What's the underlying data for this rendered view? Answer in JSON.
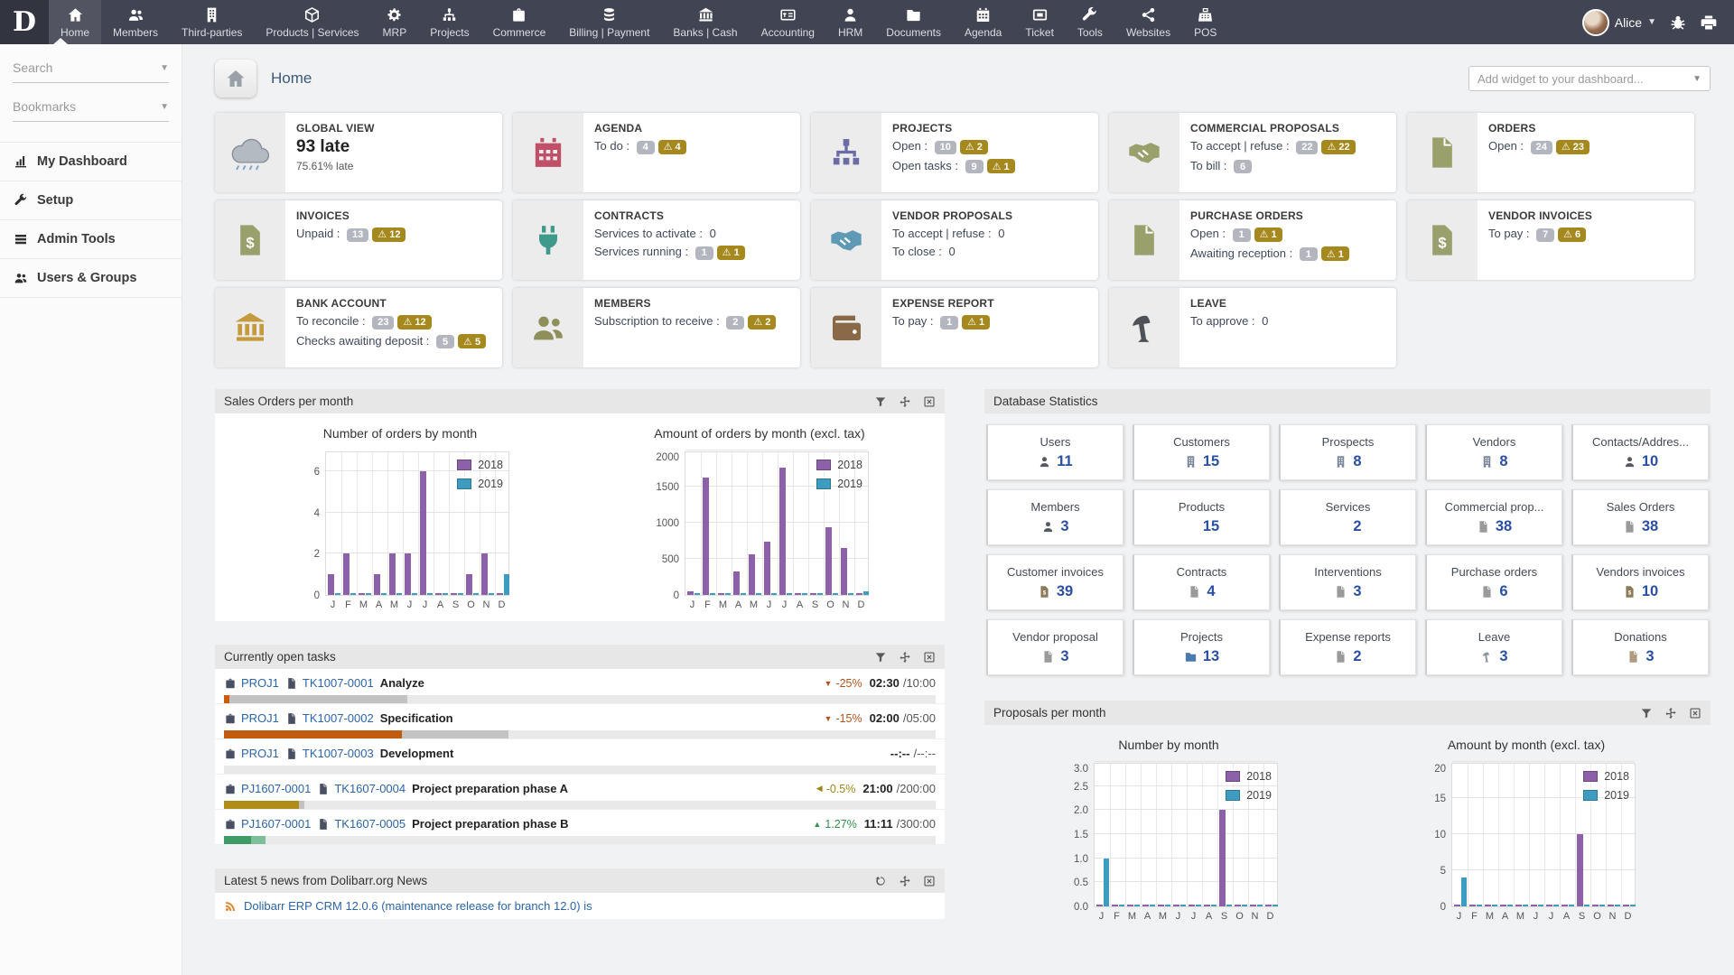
{
  "navbar": {
    "logo_text": "D",
    "items": [
      {
        "label": "Home",
        "icon": "home",
        "active": true
      },
      {
        "label": "Members",
        "icon": "users",
        "active": false
      },
      {
        "label": "Third-parties",
        "icon": "building",
        "active": false
      },
      {
        "label": "Products | Services",
        "icon": "box",
        "active": false
      },
      {
        "label": "MRP",
        "icon": "mrp",
        "active": false
      },
      {
        "label": "Projects",
        "icon": "sitemap",
        "active": false
      },
      {
        "label": "Commerce",
        "icon": "briefcase",
        "active": false
      },
      {
        "label": "Billing | Payment",
        "icon": "coins",
        "active": false
      },
      {
        "label": "Banks | Cash",
        "icon": "bank",
        "active": false
      },
      {
        "label": "Accounting",
        "icon": "calculator",
        "active": false
      },
      {
        "label": "HRM",
        "icon": "person",
        "active": false
      },
      {
        "label": "Documents",
        "icon": "folder",
        "active": false
      },
      {
        "label": "Agenda",
        "icon": "calendar",
        "active": false
      },
      {
        "label": "Ticket",
        "icon": "ticket",
        "active": false
      },
      {
        "label": "Tools",
        "icon": "wrench",
        "active": false
      },
      {
        "label": "Websites",
        "icon": "share",
        "active": false
      },
      {
        "label": "POS",
        "icon": "pos",
        "active": false
      }
    ],
    "user_name": "Alice"
  },
  "sidebar": {
    "search_placeholder": "Search",
    "bookmarks_placeholder": "Bookmarks",
    "items": [
      {
        "label": "My Dashboard",
        "icon": "chart"
      },
      {
        "label": "Setup",
        "icon": "wrench"
      },
      {
        "label": "Admin Tools",
        "icon": "list"
      },
      {
        "label": "Users & Groups",
        "icon": "users"
      }
    ]
  },
  "header": {
    "title": "Home",
    "add_widget_placeholder": "Add widget to your dashboard..."
  },
  "widgets": [
    {
      "title": "GLOBAL VIEW",
      "icon": "cloud",
      "icon_color": "#a7adb6",
      "big": "93 late",
      "sub": "75.61% late",
      "lines": []
    },
    {
      "title": "AGENDA",
      "icon": "calendar",
      "icon_color": "#bf5068",
      "lines": [
        {
          "label": "To do",
          "badge": "4",
          "warn": "4"
        }
      ]
    },
    {
      "title": "PROJECTS",
      "icon": "sitemap",
      "icon_color": "#6b6ba6",
      "lines": [
        {
          "label": "Open",
          "badge": "10",
          "warn": "2"
        },
        {
          "label": "Open tasks",
          "badge": "9",
          "warn": "1"
        }
      ]
    },
    {
      "title": "COMMERCIAL PROPOSALS",
      "icon": "handshake",
      "icon_color": "#9aa06b",
      "lines": [
        {
          "label": "To accept | refuse",
          "badge": "22",
          "warn": "22"
        },
        {
          "label": "To bill",
          "badge": "6"
        }
      ]
    },
    {
      "title": "ORDERS",
      "icon": "doc",
      "icon_color": "#9aa06b",
      "lines": [
        {
          "label": "Open",
          "badge": "24",
          "warn": "23"
        }
      ]
    },
    {
      "title": "INVOICES",
      "icon": "dollardoc",
      "icon_color": "#9aa06b",
      "lines": [
        {
          "label": "Unpaid",
          "badge": "13",
          "warn": "12"
        }
      ]
    },
    {
      "title": "CONTRACTS",
      "icon": "plug",
      "icon_color": "#3f9a8c",
      "lines": [
        {
          "label": "Services to activate",
          "plain": "0"
        },
        {
          "label": "Services running",
          "badge": "1",
          "warn": "1"
        }
      ]
    },
    {
      "title": "VENDOR PROPOSALS",
      "icon": "handshake",
      "icon_color": "#5e9ab6",
      "lines": [
        {
          "label": "To accept | refuse",
          "plain": "0"
        },
        {
          "label": "To close",
          "plain": "0"
        }
      ]
    },
    {
      "title": "PURCHASE ORDERS",
      "icon": "doc",
      "icon_color": "#9aa06b",
      "lines": [
        {
          "label": "Open",
          "badge": "1",
          "warn": "1"
        },
        {
          "label": "Awaiting reception",
          "badge": "1",
          "warn": "1"
        }
      ]
    },
    {
      "title": "VENDOR INVOICES",
      "icon": "dollardoc",
      "icon_color": "#9aa06b",
      "lines": [
        {
          "label": "To pay",
          "badge": "7",
          "warn": "6"
        }
      ]
    },
    {
      "title": "BANK ACCOUNT",
      "icon": "bank",
      "icon_color": "#c49a3c",
      "lines": [
        {
          "label": "To reconcile",
          "badge": "23",
          "warn": "12"
        },
        {
          "label": "Checks awaiting deposit",
          "badge": "5",
          "warn": "5"
        }
      ]
    },
    {
      "title": "MEMBERS",
      "icon": "users",
      "icon_color": "#8f8f5c",
      "lines": [
        {
          "label": "Subscription to receive",
          "badge": "2",
          "warn": "2"
        }
      ]
    },
    {
      "title": "EXPENSE REPORT",
      "icon": "wallet",
      "icon_color": "#8a6a46",
      "lines": [
        {
          "label": "To pay",
          "badge": "1",
          "warn": "1"
        }
      ]
    },
    {
      "title": "LEAVE",
      "icon": "palm",
      "icon_color": "#4c5258",
      "lines": [
        {
          "label": "To approve",
          "plain": "0"
        }
      ]
    }
  ],
  "panels": {
    "sales": {
      "title": "Sales Orders per month"
    },
    "tasks": {
      "title": "Currently open tasks"
    },
    "news": {
      "title": "Latest 5 news from Dolibarr.org News",
      "first_item": "Dolibarr ERP CRM 12.0.6 (maintenance release for branch 12.0) is"
    },
    "db_stats": {
      "title": "Database Statistics"
    },
    "proposals": {
      "title": "Proposals per month"
    }
  },
  "tasks": [
    {
      "project": "PROJ1",
      "ref": "TK1007-0001",
      "title": "Analyze",
      "trend": "down",
      "pct": "-25%",
      "time": "02:30",
      "total": "/10:00",
      "bar": [
        {
          "color": "#cd5b0c",
          "w": 0.8
        },
        {
          "color": "#c2c2c2",
          "w": 25
        }
      ]
    },
    {
      "project": "PROJ1",
      "ref": "TK1007-0002",
      "title": "Specification",
      "trend": "down",
      "pct": "-15%",
      "time": "02:00",
      "total": "/05:00",
      "bar": [
        {
          "color": "#c05c10",
          "w": 25
        },
        {
          "color": "#c2c2c2",
          "w": 15
        }
      ]
    },
    {
      "project": "PROJ1",
      "ref": "TK1007-0003",
      "title": "Development",
      "trend": "none",
      "pct": "",
      "time": "--:--",
      "total": "/--:--",
      "bar": []
    },
    {
      "project": "PJ1607-0001",
      "ref": "TK1607-0004",
      "title": "Project preparation phase A",
      "trend": "left",
      "pct": "-0.5%",
      "time": "21:00",
      "total": "/200:00",
      "bar": [
        {
          "color": "#b08c18",
          "w": 10.5
        },
        {
          "color": "#c2c2c2",
          "w": 0.8
        }
      ]
    },
    {
      "project": "PJ1607-0001",
      "ref": "TK1607-0005",
      "title": "Project preparation phase B",
      "trend": "up",
      "pct": "1.27%",
      "time": "11:11",
      "total": "/300:00",
      "bar": [
        {
          "color": "#3e9b63",
          "w": 3.8
        },
        {
          "color": "#7dbf9a",
          "w": 2
        }
      ]
    }
  ],
  "db_stats": [
    {
      "label": "Users",
      "icon": "person",
      "icon_color": "#555a60",
      "value": "11"
    },
    {
      "label": "Customers",
      "icon": "building",
      "icon_color": "#7d889e",
      "value": "15"
    },
    {
      "label": "Prospects",
      "icon": "building",
      "icon_color": "#7d889e",
      "value": "8"
    },
    {
      "label": "Vendors",
      "icon": "building",
      "icon_color": "#7d889e",
      "value": "8"
    },
    {
      "label": "Contacts/Addres...",
      "icon": "person",
      "icon_color": "#555a60",
      "value": "10"
    },
    {
      "label": "Members",
      "icon": "person",
      "icon_color": "#555a60",
      "value": "3"
    },
    {
      "label": "Products",
      "icon": "tag",
      "icon_color": "#b8a040",
      "value": "15"
    },
    {
      "label": "Services",
      "icon": "tag",
      "icon_color": "#b8a040",
      "value": "2"
    },
    {
      "label": "Commercial prop...",
      "icon": "doc",
      "icon_color": "#9a9a9a",
      "value": "38"
    },
    {
      "label": "Sales Orders",
      "icon": "doc",
      "icon_color": "#9a9a9a",
      "value": "38"
    },
    {
      "label": "Customer invoices",
      "icon": "dollardoc",
      "icon_color": "#8a7a5a",
      "value": "39"
    },
    {
      "label": "Contracts",
      "icon": "doc",
      "icon_color": "#9a9a9a",
      "value": "4"
    },
    {
      "label": "Interventions",
      "icon": "doc",
      "icon_color": "#9a9a9a",
      "value": "3"
    },
    {
      "label": "Purchase orders",
      "icon": "doc",
      "icon_color": "#9a9a9a",
      "value": "6"
    },
    {
      "label": "Vendors invoices",
      "icon": "dollardoc",
      "icon_color": "#8a7a5a",
      "value": "10"
    },
    {
      "label": "Vendor proposal",
      "icon": "doc",
      "icon_color": "#9a9a9a",
      "value": "3"
    },
    {
      "label": "Projects",
      "icon": "folder",
      "icon_color": "#4a7ab0",
      "value": "13"
    },
    {
      "label": "Expense reports",
      "icon": "doc",
      "icon_color": "#9a9a9a",
      "value": "2"
    },
    {
      "label": "Leave",
      "icon": "palm",
      "icon_color": "#8a98a0",
      "value": "3"
    },
    {
      "label": "Donations",
      "icon": "doc",
      "icon_color": "#b09a80",
      "value": "3"
    }
  ],
  "chart_data": [
    {
      "type": "bar",
      "title": "Number of orders by month",
      "categories": [
        "J",
        "F",
        "M",
        "A",
        "M",
        "J",
        "J",
        "A",
        "S",
        "O",
        "N",
        "D"
      ],
      "series": [
        {
          "name": "2018",
          "color": "#8d61a9",
          "values": [
            1,
            2,
            0,
            1,
            2,
            2,
            6,
            0,
            0,
            1,
            2,
            0
          ]
        },
        {
          "name": "2019",
          "color": "#3d9cc0",
          "values": [
            0,
            0,
            0,
            0,
            0,
            0,
            0,
            0,
            0,
            0,
            0,
            1
          ]
        }
      ],
      "ylim": [
        0,
        7
      ],
      "yticks": [
        0,
        2,
        4,
        6
      ],
      "ytick_labels": [
        "0",
        "2",
        "4",
        "6"
      ],
      "grid": true,
      "legend": "top-right"
    },
    {
      "type": "bar",
      "title": "Amount of orders by month (excl. tax)",
      "categories": [
        "J",
        "F",
        "M",
        "A",
        "M",
        "J",
        "J",
        "A",
        "S",
        "O",
        "N",
        "D"
      ],
      "series": [
        {
          "name": "2018",
          "color": "#8d61a9",
          "values": [
            50,
            1620,
            0,
            330,
            560,
            740,
            1760,
            0,
            0,
            940,
            650,
            0
          ]
        },
        {
          "name": "2019",
          "color": "#3d9cc0",
          "values": [
            0,
            0,
            0,
            0,
            0,
            0,
            0,
            0,
            0,
            0,
            0,
            50
          ]
        }
      ],
      "ylim": [
        0,
        2000
      ],
      "yticks": [
        0,
        500,
        1000,
        1500,
        2000
      ],
      "ytick_labels": [
        "0",
        "500",
        "1000",
        "1500",
        "2000"
      ],
      "grid": true,
      "legend": "top-right"
    },
    {
      "type": "bar",
      "title": "Number by month",
      "categories": [
        "J",
        "F",
        "M",
        "A",
        "M",
        "J",
        "J",
        "A",
        "S",
        "O",
        "N",
        "D"
      ],
      "series": [
        {
          "name": "2018",
          "color": "#8d61a9",
          "values": [
            0,
            0,
            0,
            0,
            0,
            0,
            0,
            0,
            2,
            0,
            0,
            0
          ]
        },
        {
          "name": "2019",
          "color": "#3d9cc0",
          "values": [
            1,
            0,
            0,
            0,
            0,
            0,
            0,
            0,
            0,
            0,
            0,
            0
          ]
        }
      ],
      "ylim": [
        0,
        3
      ],
      "yticks": [
        0,
        0.5,
        1,
        1.5,
        2,
        2.5,
        3
      ],
      "ytick_labels": [
        "0.0",
        "0.5",
        "1.0",
        "1.5",
        "2.0",
        "2.5",
        "3.0"
      ],
      "grid": true,
      "legend": "top-right"
    },
    {
      "type": "bar",
      "title": "Amount by month (excl. tax)",
      "categories": [
        "J",
        "F",
        "M",
        "A",
        "M",
        "J",
        "J",
        "A",
        "S",
        "O",
        "N",
        "D"
      ],
      "series": [
        {
          "name": "2018",
          "color": "#8d61a9",
          "values": [
            0,
            0,
            0,
            0,
            0,
            0,
            0,
            0,
            10,
            0,
            0,
            0
          ]
        },
        {
          "name": "2019",
          "color": "#3d9cc0",
          "values": [
            4,
            0,
            0,
            0,
            0,
            0,
            0,
            0,
            0,
            0,
            0,
            0
          ]
        }
      ],
      "ylim": [
        0,
        20
      ],
      "yticks": [
        0,
        5,
        10,
        15,
        20
      ],
      "ytick_labels": [
        "0",
        "5",
        "10",
        "15",
        "20"
      ],
      "grid": true,
      "legend": "top-right"
    }
  ]
}
